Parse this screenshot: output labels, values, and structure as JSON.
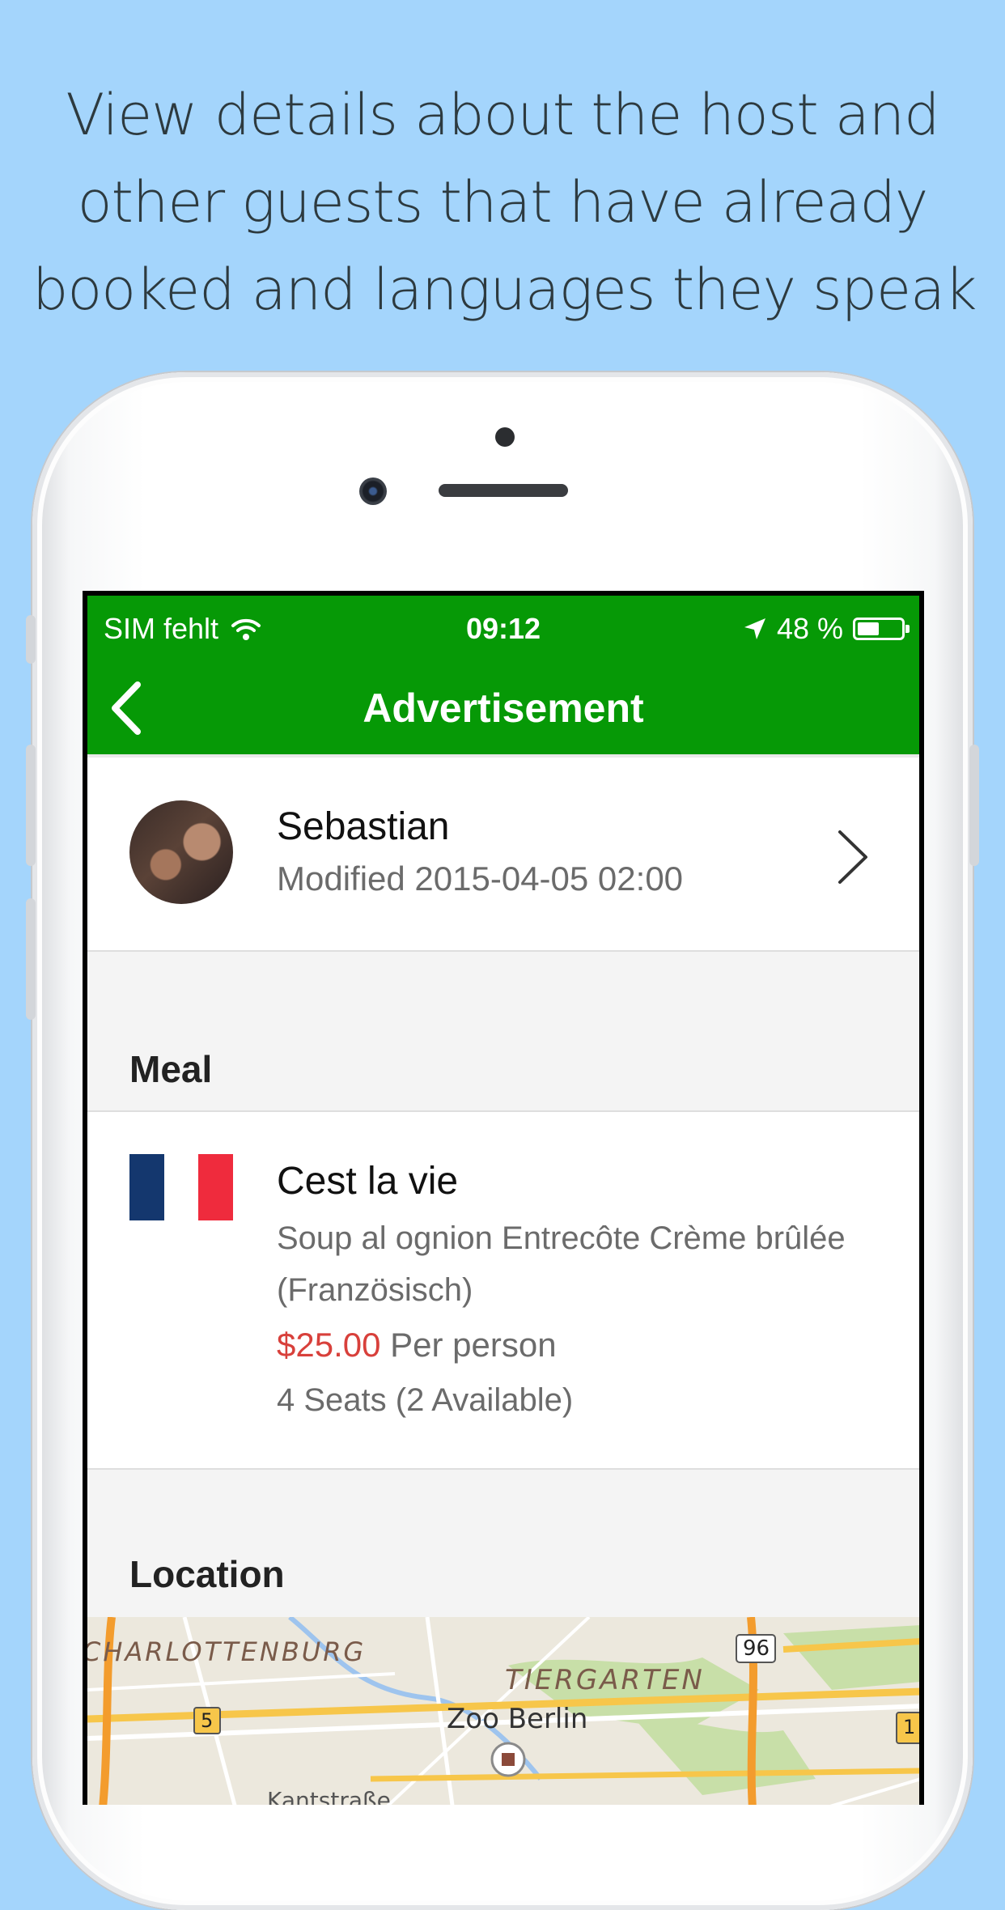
{
  "headline": {
    "line1": "View details about the host and",
    "line2": "other guests that have already",
    "line3": "booked and languages they speak"
  },
  "status_bar": {
    "carrier": "SIM fehlt",
    "time": "09:12",
    "battery": "48 %"
  },
  "nav": {
    "title": "Advertisement"
  },
  "host": {
    "name": "Sebastian",
    "modified": "Modified 2015-04-05 02:00"
  },
  "meal_section": {
    "heading": "Meal",
    "title": "Cest la vie",
    "description": "Soup al ognion Entrecôte Crème brûlée (Französisch)",
    "price": "$25.00",
    "price_suffix": "Per person",
    "seats": "4 Seats (2 Available)"
  },
  "location_section": {
    "heading": "Location",
    "map_labels": {
      "district1": "CHARLOTTENBURG",
      "district2": "TIERGARTEN",
      "poi": "Zoo Berlin",
      "street": "Kantstraße",
      "road_96": "96",
      "road_5": "5",
      "road_1": "1"
    }
  },
  "colors": {
    "background": "#a4d5fc",
    "accent_green": "#069906",
    "price_red": "#d8403b",
    "flag_blue": "#14376e",
    "flag_red": "#ef2b3d"
  },
  "icons": [
    "wifi-icon",
    "location-arrow-icon",
    "battery-icon",
    "back-chevron-icon",
    "chevron-right-icon",
    "france-flag-icon",
    "map-pin-icon"
  ]
}
